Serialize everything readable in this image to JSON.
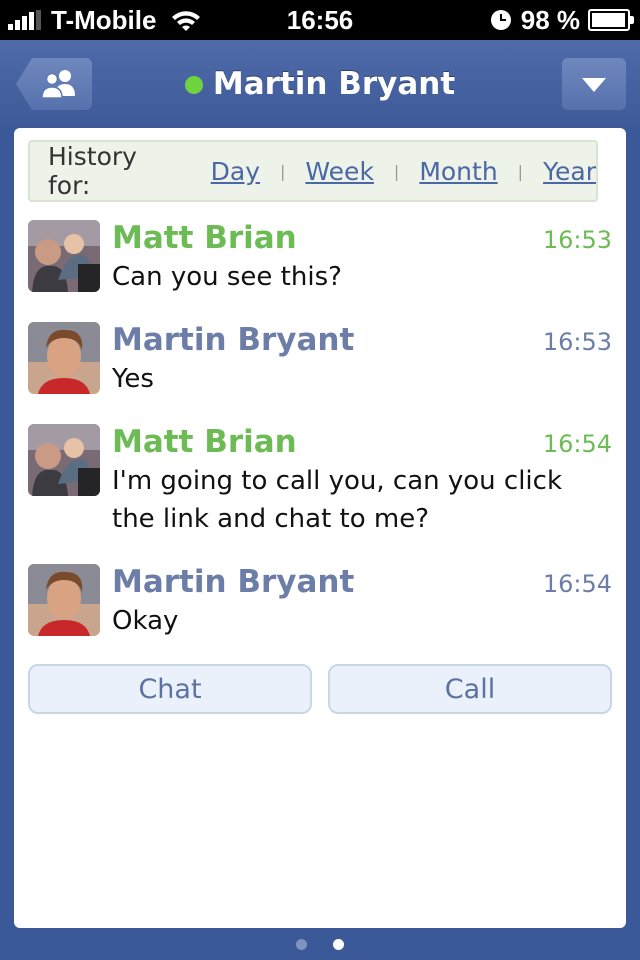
{
  "status_bar": {
    "carrier": "T-Mobile",
    "time": "16:56",
    "battery": "98 %",
    "battery_level": 0.98
  },
  "header": {
    "title": "Martin Bryant",
    "online_color": "#6fd23f"
  },
  "history": {
    "label": "History for:",
    "links": [
      "Day",
      "Week",
      "Month",
      "Year"
    ]
  },
  "messages": [
    {
      "name": "Matt Brian",
      "time": "16:53",
      "text": "Can you see this?",
      "color": "#6dbb55"
    },
    {
      "name": "Martin Bryant",
      "time": "16:53",
      "text": "Yes",
      "color": "#6c7ea7"
    },
    {
      "name": "Matt Brian",
      "time": "16:54",
      "text": "I'm going to call you, can you click the link and chat to me?",
      "color": "#6dbb55"
    },
    {
      "name": "Martin Bryant",
      "time": "16:54",
      "text": "Okay",
      "color": "#6c7ea7"
    }
  ],
  "actions": {
    "chat_label": "Chat",
    "call_label": "Call"
  },
  "pager": {
    "pages": 2,
    "current": 2
  },
  "colors": {
    "background": "#3b5998",
    "link": "#4b67a5",
    "matt_name": "#6dbb55",
    "martin_name": "#6c7ea7"
  }
}
